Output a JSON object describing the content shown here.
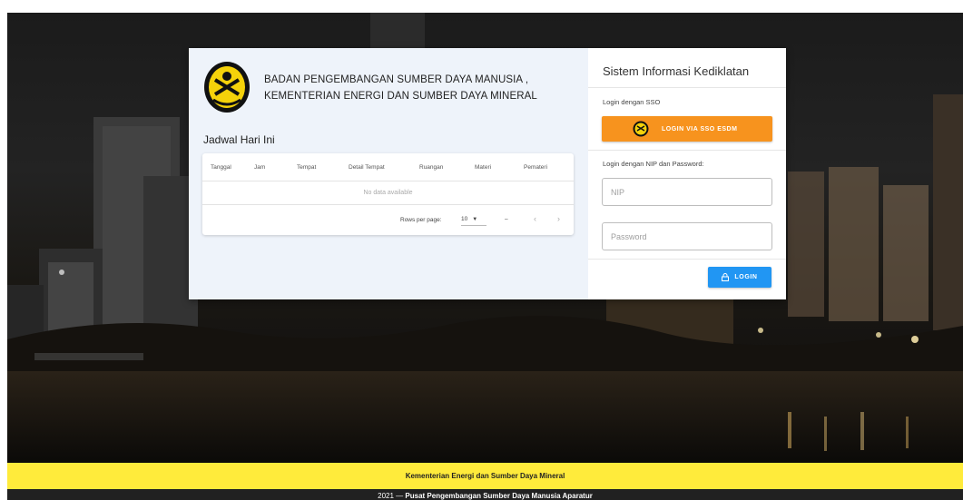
{
  "org": {
    "line1": "BADAN PENGEMBANGAN SUMBER DAYA MANUSIA ,",
    "line2": "KEMENTERIAN ENERGI DAN SUMBER DAYA MINERAL",
    "logo_icon": "esdm-logo-icon"
  },
  "schedule": {
    "title": "Jadwal Hari Ini",
    "columns": [
      "Tanggal",
      "Jam",
      "Tempat",
      "Detail Tempat",
      "Ruangan",
      "Materi",
      "Pemateri"
    ],
    "empty_text": "No data available",
    "rows_per_page_label": "Rows per page:",
    "rows_per_page_value": "10",
    "range_text": "–"
  },
  "login": {
    "title": "Sistem Informasi Kediklatan",
    "sso_label": "Login dengan SSO",
    "sso_button": "LOGIN VIA SSO ESDM",
    "nip_label": "Login dengan NIP dan Password:",
    "nip_placeholder": "NIP",
    "password_placeholder": "Password",
    "login_button": "LOGIN"
  },
  "footer": {
    "ministry": "Kementerian Energi dan Sumber Daya Mineral",
    "year": "2021 —",
    "center": "Pusat Pengembangan Sumber Daya Manusia Aparatur"
  },
  "colors": {
    "sso_button": "#f7931e",
    "login_button": "#2196f3",
    "footer_yellow": "#ffeb3b",
    "footer_dark": "#212121"
  }
}
